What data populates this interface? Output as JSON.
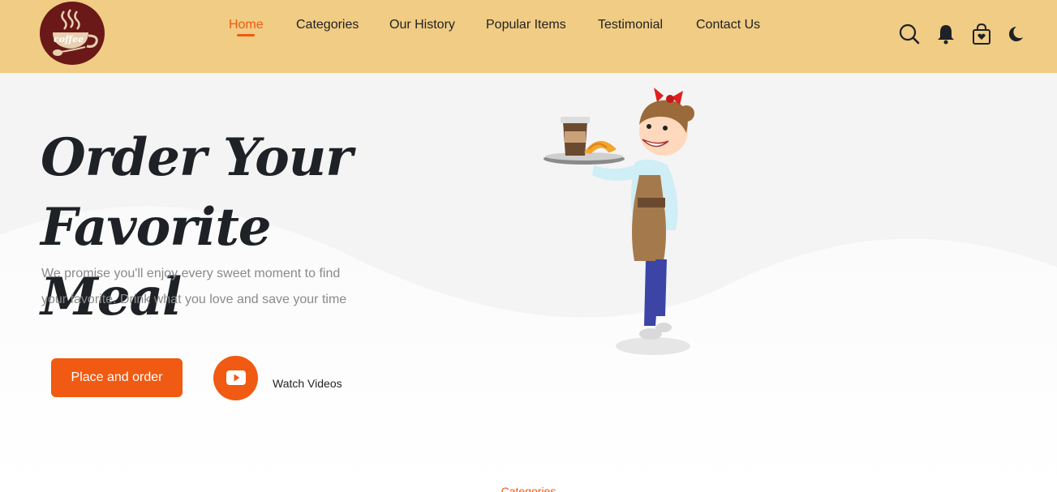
{
  "brand": {
    "logo_text": "coffee"
  },
  "nav": {
    "items": [
      {
        "label": "Home",
        "active": true
      },
      {
        "label": "Categories",
        "active": false
      },
      {
        "label": "Our History",
        "active": false
      },
      {
        "label": "Popular Items",
        "active": false
      },
      {
        "label": "Testimonial",
        "active": false
      },
      {
        "label": "Contact Us",
        "active": false
      }
    ]
  },
  "header_icons": [
    "search-icon",
    "bell-icon",
    "shopping-bag-icon",
    "moon-icon"
  ],
  "hero": {
    "title": "Order Your Favorite Meal",
    "description": "We promise you'll enjoy every sweet moment to find your favorite. Drink what you love and save your time",
    "order_button": "Place and order",
    "watch_label": "Watch Videos"
  },
  "next_section": {
    "label": "Categories"
  },
  "colors": {
    "header_bg": "#f0cc84",
    "accent": "#f05a12",
    "logo_bg": "#6a1818",
    "title": "#1e2126"
  }
}
